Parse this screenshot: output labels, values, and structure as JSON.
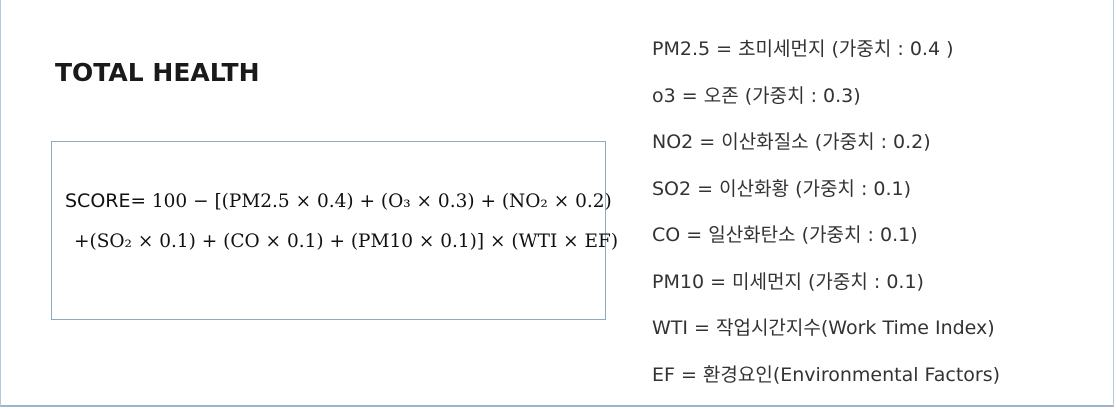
{
  "title": "TOTAL HEALTH",
  "formula": {
    "line1": {
      "label": "SCORE",
      "expr": "= 100 − [(PM2.5 × 0.4) + (O₃ × 0.3) + (NO₂ × 0.2)"
    },
    "line2": {
      "expr": "+(SO₂ × 0.1) + (CO × 0.1) + (PM10 × 0.1)] × (WTI × EF)"
    }
  },
  "definitions": [
    "PM2.5  =  초미세먼지 (가중치 : 0.4 )",
    "o3  =  오존 (가중치 : 0.3)",
    "NO2  =  이산화질소 (가중치 : 0.2)",
    "SO2  =  이산화황 (가중치 : 0.1)",
    "CO  =  일산화탄소 (가중치 : 0.1)",
    "PM10  =  미세먼지 (가중치 : 0.1)",
    "WTI   =  작업시간지수(Work Time Index)",
    "EF  =  환경요인(Environmental Factors)"
  ],
  "colors": {
    "box_border": "#8fa8c4",
    "frame_border": "#b8c8dc",
    "text": "#333333",
    "title": "#1a1a1a"
  }
}
